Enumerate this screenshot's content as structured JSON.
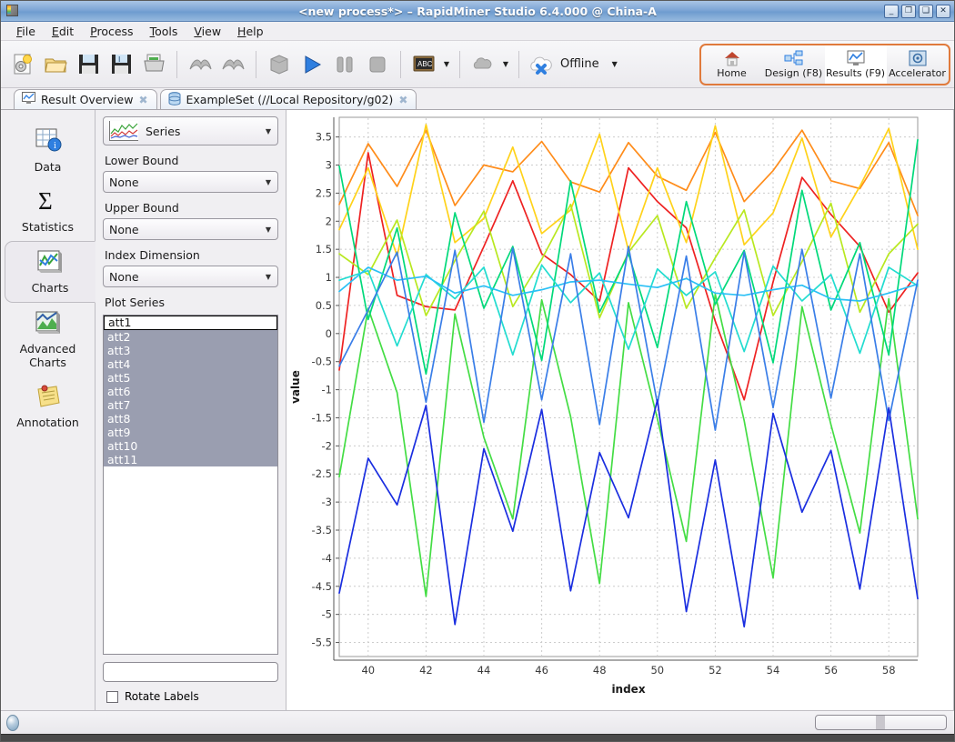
{
  "window": {
    "title": "<new process*> – RapidMiner Studio 6.4.000 @ China-A",
    "icon": "rapidminer-cube-icon",
    "buttons": {
      "minimize": "_",
      "restore": "❐",
      "maximize": "❑",
      "close": "✕"
    }
  },
  "menubar": {
    "items": [
      {
        "label": "File",
        "mnemonic": "F"
      },
      {
        "label": "Edit",
        "mnemonic": "E"
      },
      {
        "label": "Process",
        "mnemonic": "P"
      },
      {
        "label": "Tools",
        "mnemonic": "T"
      },
      {
        "label": "View",
        "mnemonic": "V"
      },
      {
        "label": "Help",
        "mnemonic": "H"
      }
    ]
  },
  "toolbar": {
    "buttons": [
      {
        "name": "new-process-icon",
        "tooltip": "New Process"
      },
      {
        "name": "open-process-icon",
        "tooltip": "Open Process"
      },
      {
        "name": "save-icon",
        "tooltip": "Save"
      },
      {
        "name": "save-as-icon",
        "tooltip": "Save As"
      },
      {
        "name": "print-icon",
        "tooltip": "Print"
      },
      {
        "name": "undo-icon",
        "tooltip": "Undo"
      },
      {
        "name": "redo-icon",
        "tooltip": "Redo"
      },
      {
        "name": "process-icon",
        "tooltip": "Process"
      },
      {
        "name": "run-icon",
        "tooltip": "Run"
      },
      {
        "name": "pause-icon",
        "tooltip": "Pause"
      },
      {
        "name": "stop-icon",
        "tooltip": "Stop"
      },
      {
        "name": "abc-validate-icon",
        "tooltip": "Validate"
      },
      {
        "name": "cloud-share-icon",
        "tooltip": "Share"
      }
    ],
    "connection_label": "Offline"
  },
  "perspectives": [
    {
      "label": "Home",
      "icon": "home-icon",
      "active": false
    },
    {
      "label": "Design (F8)",
      "icon": "design-icon",
      "active": false
    },
    {
      "label": "Results (F9)",
      "icon": "results-chart-icon",
      "active": true
    },
    {
      "label": "Accelerator",
      "icon": "accelerator-gear-icon",
      "active": false
    }
  ],
  "tabs": [
    {
      "label": "Result Overview",
      "icon": "chart-tab-icon",
      "close": "✖",
      "active": false
    },
    {
      "label": "ExampleSet (//Local Repository/g02)",
      "icon": "dataset-tab-icon",
      "close": "✖",
      "active": true
    }
  ],
  "rail": {
    "items": [
      {
        "label": "Data",
        "icon": "data-table-icon",
        "active": false
      },
      {
        "label": "Statistics",
        "icon": "sigma-icon",
        "active": false
      },
      {
        "label": "Charts",
        "icon": "charts-icon",
        "active": true
      },
      {
        "label": "Advanced Charts",
        "icon": "advanced-charts-icon",
        "active": false
      },
      {
        "label": "Annotation",
        "icon": "annotation-notepad-icon",
        "active": false
      }
    ]
  },
  "controls": {
    "chart_type": {
      "label": "Series",
      "icon": "series-chart-icon"
    },
    "lower_bound": {
      "label": "Lower Bound",
      "value": "None"
    },
    "upper_bound": {
      "label": "Upper Bound",
      "value": "None"
    },
    "index_dimension": {
      "label": "Index Dimension",
      "value": "None"
    },
    "plot_series": {
      "label": "Plot Series",
      "items": [
        {
          "name": "att1",
          "selected": false,
          "focused": true
        },
        {
          "name": "att2",
          "selected": true,
          "focused": false
        },
        {
          "name": "att3",
          "selected": true,
          "focused": false
        },
        {
          "name": "att4",
          "selected": true,
          "focused": false
        },
        {
          "name": "att5",
          "selected": true,
          "focused": false
        },
        {
          "name": "att6",
          "selected": true,
          "focused": false
        },
        {
          "name": "att7",
          "selected": true,
          "focused": false
        },
        {
          "name": "att8",
          "selected": true,
          "focused": false
        },
        {
          "name": "att9",
          "selected": true,
          "focused": false
        },
        {
          "name": "att10",
          "selected": true,
          "focused": false
        },
        {
          "name": "att11",
          "selected": true,
          "focused": false
        }
      ]
    },
    "filter_field": {
      "value": "",
      "placeholder": ""
    },
    "rotate_labels": {
      "label": "Rotate Labels",
      "checked": false
    }
  },
  "chart_data": {
    "type": "line",
    "title": "",
    "xlabel": "index",
    "ylabel": "value",
    "xlim": [
      39,
      59
    ],
    "ylim": [
      -5.75,
      3.85
    ],
    "xticks": [
      40,
      42,
      44,
      46,
      48,
      50,
      52,
      54,
      56,
      58
    ],
    "yticks": [
      3.5,
      3,
      2.5,
      2,
      1.5,
      1,
      0.5,
      0,
      -0.5,
      -1,
      -1.5,
      -2,
      -2.5,
      -3,
      -3.5,
      -4,
      -4.5,
      -5,
      -5.5
    ],
    "grid": true,
    "legend": "none",
    "x": [
      39,
      40,
      41,
      42,
      43,
      44,
      45,
      46,
      47,
      48,
      49,
      50,
      51,
      52,
      53,
      54,
      55,
      56,
      57,
      58,
      59
    ],
    "series": [
      {
        "name": "att2",
        "color": "#ee2222",
        "values": [
          -0.65,
          3.22,
          0.68,
          0.48,
          0.42,
          1.55,
          2.72,
          1.42,
          1.05,
          0.58,
          2.95,
          2.35,
          1.88,
          0.22,
          -1.18,
          0.92,
          2.78,
          2.12,
          1.55,
          0.38,
          1.08
        ]
      },
      {
        "name": "att3",
        "color": "#ff8c1a",
        "values": [
          2.3,
          3.38,
          2.62,
          3.62,
          2.28,
          3.0,
          2.88,
          3.42,
          2.7,
          2.52,
          3.4,
          2.8,
          2.55,
          3.58,
          2.35,
          2.9,
          3.62,
          2.72,
          2.58,
          3.4,
          2.1
        ]
      },
      {
        "name": "att4",
        "color": "#ffd21a",
        "values": [
          1.85,
          2.95,
          1.38,
          3.72,
          1.62,
          2.05,
          3.32,
          1.78,
          2.2,
          3.55,
          1.48,
          2.95,
          1.62,
          3.7,
          1.58,
          2.15,
          3.48,
          1.72,
          2.62,
          3.65,
          1.5
        ]
      },
      {
        "name": "att5",
        "color": "#b8e820",
        "values": [
          1.42,
          1.05,
          2.02,
          0.32,
          1.3,
          2.18,
          0.48,
          1.32,
          2.3,
          0.28,
          1.45,
          2.1,
          0.45,
          1.35,
          2.2,
          0.32,
          1.28,
          2.32,
          0.38,
          1.42,
          1.95
        ]
      },
      {
        "name": "att6",
        "color": "#44dd44",
        "values": [
          -2.55,
          0.45,
          -1.05,
          -4.68,
          0.35,
          -1.85,
          -3.3,
          0.6,
          -1.48,
          -4.45,
          0.55,
          -1.52,
          -3.7,
          0.7,
          -1.55,
          -4.35,
          0.48,
          -1.62,
          -3.55,
          0.62,
          -3.3
        ]
      },
      {
        "name": "att7",
        "color": "#00d97a",
        "values": [
          2.98,
          0.25,
          1.88,
          -0.72,
          2.15,
          0.45,
          1.55,
          -0.48,
          2.72,
          0.38,
          1.42,
          -0.25,
          2.35,
          0.52,
          1.48,
          -0.52,
          2.55,
          0.42,
          1.62,
          -0.38,
          3.45
        ]
      },
      {
        "name": "att8",
        "color": "#22dcd0",
        "values": [
          0.95,
          1.12,
          -0.22,
          1.05,
          0.62,
          1.18,
          -0.38,
          1.22,
          0.55,
          1.08,
          -0.28,
          1.15,
          0.68,
          1.1,
          -0.32,
          1.2,
          0.58,
          1.05,
          -0.35,
          1.18,
          0.85
        ]
      },
      {
        "name": "att9",
        "color": "#2ac0f5",
        "values": [
          0.75,
          1.18,
          0.95,
          1.02,
          0.72,
          0.85,
          0.68,
          0.78,
          0.92,
          0.95,
          0.88,
          0.82,
          0.98,
          0.72,
          0.68,
          0.78,
          0.86,
          0.62,
          0.58,
          0.72,
          0.88
        ]
      },
      {
        "name": "att10",
        "color": "#3a7ee8",
        "values": [
          -0.58,
          0.42,
          1.45,
          -1.22,
          1.48,
          -1.58,
          1.52,
          -1.18,
          1.42,
          -1.62,
          1.55,
          -1.25,
          1.38,
          -1.72,
          1.45,
          -1.32,
          1.5,
          -1.15,
          1.42,
          -1.55,
          0.95
        ]
      },
      {
        "name": "att11",
        "color": "#1a2ee0",
        "values": [
          -4.62,
          -2.22,
          -3.05,
          -1.28,
          -5.18,
          -2.05,
          -3.52,
          -1.35,
          -4.58,
          -2.12,
          -3.28,
          -1.18,
          -4.95,
          -2.25,
          -5.22,
          -1.42,
          -3.18,
          -2.08,
          -4.55,
          -1.32,
          -4.72
        ]
      }
    ]
  },
  "statusbar": {
    "memory": {
      "label": ""
    }
  }
}
